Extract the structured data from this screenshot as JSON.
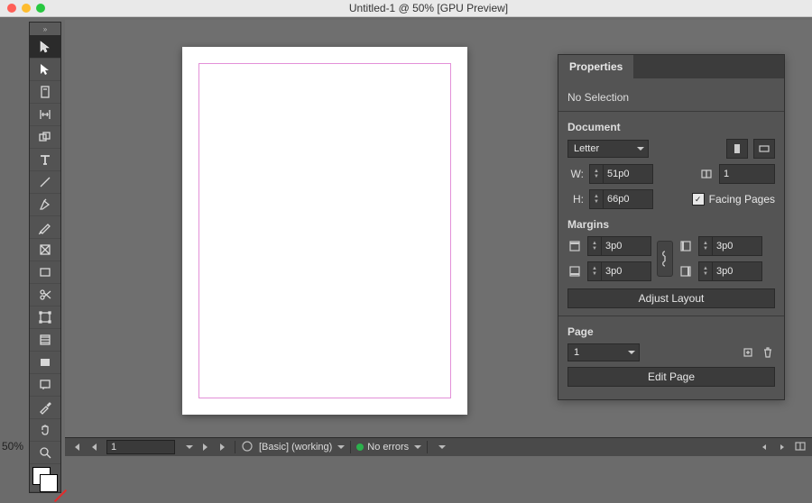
{
  "titlebar": {
    "title": "Untitled-1 @ 50% [GPU Preview]"
  },
  "zoom_label": "50%",
  "properties": {
    "tab_label": "Properties",
    "selection_status": "No Selection",
    "document_heading": "Document",
    "page_size": "Letter",
    "width_label": "W:",
    "height_label": "H:",
    "width_value": "51p0",
    "height_value": "66p0",
    "pages_value": "1",
    "facing_pages_label": "Facing Pages",
    "facing_pages_checked": true,
    "margins_heading": "Margins",
    "margin_top": "3p0",
    "margin_bottom": "3p0",
    "margin_left": "3p0",
    "margin_right": "3p0",
    "adjust_layout_label": "Adjust Layout",
    "page_heading": "Page",
    "page_number": "1",
    "edit_page_label": "Edit Page"
  },
  "statusbar": {
    "page_value": "1",
    "preflight_profile": "[Basic]  (working)",
    "errors_label": "No errors"
  }
}
